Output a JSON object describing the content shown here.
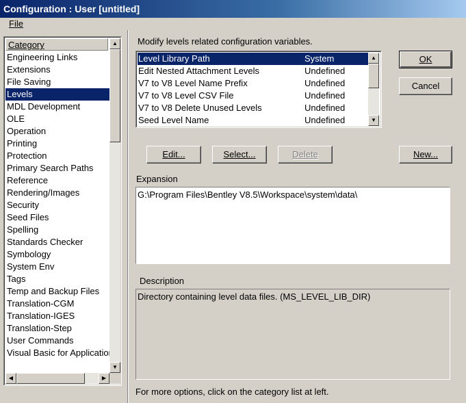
{
  "window": {
    "title": "Configuration : User [untitled]"
  },
  "menu": {
    "file_label": "File"
  },
  "category": {
    "header": "Category",
    "items": [
      "Engineering Links",
      "Extensions",
      "File Saving",
      "Levels",
      "MDL Development",
      "OLE",
      "Operation",
      "Printing",
      "Protection",
      "Primary Search Paths",
      "Reference",
      "Rendering/Images",
      "Security",
      "Seed Files",
      "Spelling",
      "Standards Checker",
      "Symbology",
      "System Env",
      "Tags",
      "Temp and Backup Files",
      "Translation-CGM",
      "Translation-IGES",
      "Translation-Step",
      "User Commands",
      "Visual Basic for Applications"
    ],
    "selected": "Levels"
  },
  "variables": {
    "caption": "Modify levels related configuration variables.",
    "rows": [
      {
        "name": "Level Library Path",
        "status": "System"
      },
      {
        "name": "Edit Nested Attachment Levels",
        "status": "Undefined"
      },
      {
        "name": "V7 to V8 Level Name Prefix",
        "status": "Undefined"
      },
      {
        "name": "V7 to V8 Level CSV File",
        "status": "Undefined"
      },
      {
        "name": "V7 to V8 Delete Unused Levels",
        "status": "Undefined"
      },
      {
        "name": "Seed Level Name",
        "status": "Undefined"
      }
    ]
  },
  "buttons": {
    "ok": "OK",
    "cancel": "Cancel",
    "edit": "Edit...",
    "select": "Select...",
    "delete": "Delete",
    "new": "New..."
  },
  "expansion": {
    "label": "Expansion",
    "value": "G:\\Program Files\\Bentley V8.5\\Workspace\\system\\data\\"
  },
  "description": {
    "label": "Description",
    "value": "Directory containing level data files. (MS_LEVEL_LIB_DIR)"
  },
  "footer": "For more options, click on the category list at left."
}
